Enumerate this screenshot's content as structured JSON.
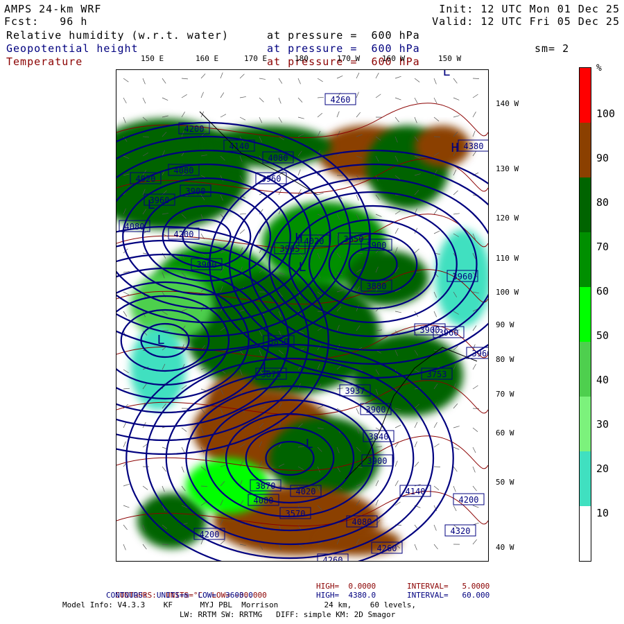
{
  "header": {
    "model": "AMPS 24-km WRF",
    "forecast": "Fcst:   96 h",
    "init": "Init: 12 UTC Mon 01 Dec 25",
    "valid": "Valid: 12 UTC Fri 05 Dec 25",
    "fields": [
      {
        "name": "Relative humidity (w.r.t. water)",
        "level": "at pressure =  600 hPa",
        "color": "#000000"
      },
      {
        "name": "Geopotential height",
        "level": "at pressure =  600 hPa",
        "color": "#00007f"
      },
      {
        "name": "Temperature",
        "level": "at pressure =  600 hPa",
        "color": "#8b0000"
      }
    ],
    "smoothing": "sm= 2"
  },
  "map": {
    "top_lon_labels": [
      "150 E",
      "160 E",
      "170 E",
      "180",
      "170 W",
      "160 W",
      "150 W"
    ],
    "right_lon_labels": [
      "140 W",
      "130 W",
      "120 W",
      "110 W",
      "100 W",
      "90 W",
      "80 W",
      "70 W",
      "60 W",
      "50 W",
      "40 W"
    ],
    "contour_labels": [
      "4260",
      "4380",
      "4080",
      "4200",
      "4140",
      "4080",
      "4020",
      "3900",
      "3960",
      "3960",
      "4080",
      "4200",
      "4020",
      "3900",
      "3850",
      "3905",
      "3900",
      "3880",
      "3960",
      "3960",
      "3900",
      "3850",
      "3873",
      "3937",
      "3753",
      "3900",
      "3960",
      "3840",
      "3900",
      "3870",
      "3570",
      "4020",
      "4080",
      "4140",
      "4080",
      "4260",
      "4260",
      "4200",
      "4320",
      "4289",
      "4200"
    ],
    "highs_lows": [
      "H",
      "L",
      "L",
      "L",
      "L",
      "L",
      "L",
      "H"
    ],
    "colors": {
      "height_contour": "#00007f",
      "temp_contour": "#8b0000",
      "coast": "#000000"
    }
  },
  "colorbar": {
    "unit": "%",
    "ticks": [
      "100",
      "90",
      "80",
      "70",
      "60",
      "50",
      "40",
      "30",
      "20",
      "10"
    ],
    "bands": [
      {
        "from": 0,
        "to": 30,
        "color": "#ffffff"
      },
      {
        "from": 30,
        "to": 40,
        "color": "#40e0c0"
      },
      {
        "from": 40,
        "to": 50,
        "color": "#7cf27c"
      },
      {
        "from": 50,
        "to": 60,
        "color": "#4ecf4e"
      },
      {
        "from": 60,
        "to": 70,
        "color": "#00ff00"
      },
      {
        "from": 70,
        "to": 80,
        "color": "#008f00"
      },
      {
        "from": 80,
        "to": 90,
        "color": "#006400"
      },
      {
        "from": 90,
        "to": 100,
        "color": "#8b4000"
      },
      {
        "from": 100,
        "to": 110,
        "color": "#ff0000"
      }
    ]
  },
  "footer": {
    "line1": {
      "label": "CONTOURS:  UNITS=°C  LOW= -30.000",
      "high": "HIGH=  0.0000",
      "interval": "INTERVAL=   5.0000"
    },
    "line2": {
      "label": "CONTOURS:  UNITS=m  LOW=  3600.0",
      "high": "HIGH=  4380.0",
      "interval": "INTERVAL=   60.000"
    },
    "line3": "Model Info: V4.3.3    KF      MYJ PBL  Morrison          24 km,    60 levels,",
    "line4": "LW: RRTM SW: RRTMG   DIFF: simple KM: 2D Smagor"
  }
}
